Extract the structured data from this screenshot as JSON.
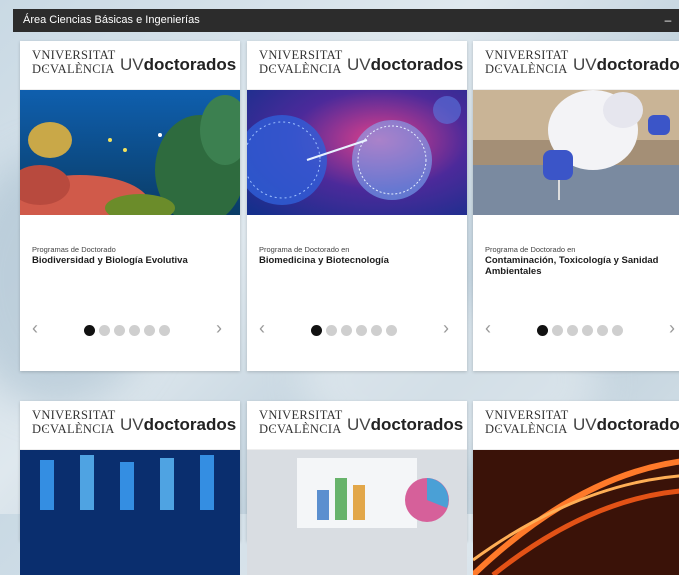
{
  "panel": {
    "title": "Área Ciencias Básicas e Ingenierías",
    "collapse_label": "–"
  },
  "brand": {
    "university_line1": "VNIVERSITAT",
    "university_line2": "DϾVALÈNCIA",
    "uv_prefix": "UV",
    "doctorados": "doctorados"
  },
  "nav": {
    "prev": "‹",
    "next": "›",
    "dot_count": 6,
    "active_dot": 0
  },
  "cards": [
    {
      "subtitle": "Programas de Doctorado",
      "title": "Biodiversidad y Biología Evolutiva",
      "image": "coral-reef"
    },
    {
      "subtitle": "Programa de Doctorado en",
      "title": "Biomedicina y Biotecnología",
      "image": "virus-cell"
    },
    {
      "subtitle": "Programa de Doctorado en",
      "title": "Contaminación, Toxicología y Sanidad Ambientales",
      "image": "lab-sampling"
    },
    {
      "subtitle": "",
      "title": "",
      "image": "lab-vials"
    },
    {
      "subtitle": "",
      "title": "",
      "image": "data-charts"
    },
    {
      "subtitle": "",
      "title": "",
      "image": "light-trails"
    }
  ]
}
